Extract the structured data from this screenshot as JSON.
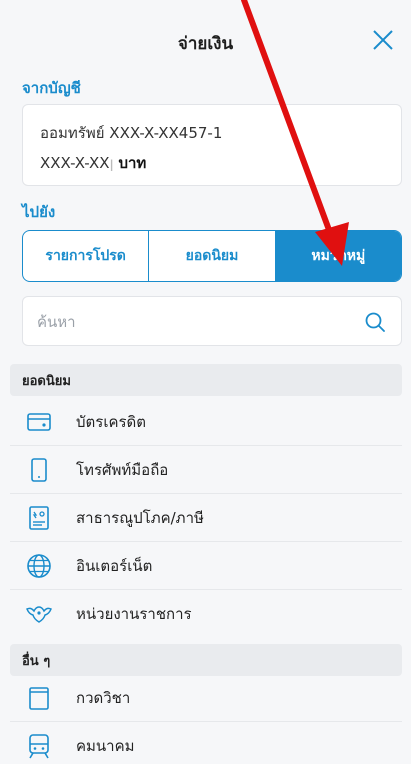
{
  "header": {
    "title": "จ่ายเงิน"
  },
  "from_section": {
    "label": "จากบัญชี",
    "account_line1": "ออมทรัพย์ XXX-X-XX457-1",
    "account_line2_number": "XXX-X-XX",
    "account_line2_suffix": "บาท"
  },
  "to_section": {
    "label": "ไปยัง"
  },
  "tabs": [
    {
      "label": "รายการโปรด",
      "active": false
    },
    {
      "label": "ยอดนิยม",
      "active": false
    },
    {
      "label": "หมวดหมู่",
      "active": true
    }
  ],
  "search": {
    "placeholder": "ค้นหา"
  },
  "groups": [
    {
      "title": "ยอดนิยม",
      "items": [
        {
          "label": "บัตรเครดิต",
          "icon": "credit-card-icon"
        },
        {
          "label": "โทรศัพท์มือถือ",
          "icon": "mobile-phone-icon"
        },
        {
          "label": "สาธารณูปโภค/ภาษี",
          "icon": "utility-bill-icon"
        },
        {
          "label": "อินเตอร์เน็ต",
          "icon": "globe-icon"
        },
        {
          "label": "หน่วยงานราชการ",
          "icon": "garuda-emblem-icon"
        }
      ]
    },
    {
      "title": "อื่น ๆ",
      "items": [
        {
          "label": "กวดวิชา",
          "icon": "book-icon"
        },
        {
          "label": "คมนาคม",
          "icon": "train-icon"
        }
      ]
    }
  ],
  "colors": {
    "accent": "#1a8ccc",
    "arrow": "#e01010"
  }
}
